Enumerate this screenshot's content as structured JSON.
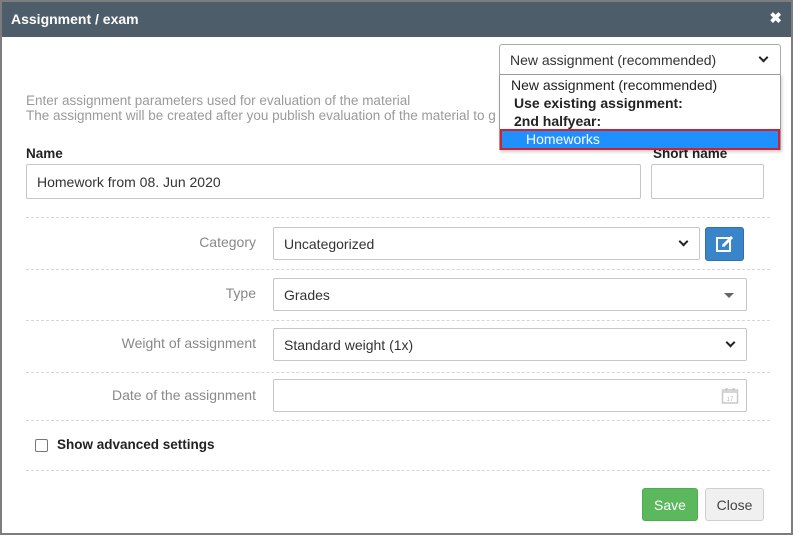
{
  "dialog": {
    "title": "Assignment / exam",
    "close_icon": "close-x-icon"
  },
  "assignment_select": {
    "value": "New assignment (recommended)",
    "options": {
      "new": "New assignment (recommended)",
      "use_existing_group": "Use existing assignment:",
      "half_year_group": "2nd halfyear:",
      "homeworks": "Homeworks"
    },
    "selected_option": "Homeworks",
    "highlight_color": "#1e90ff",
    "selection_outline_color": "#d0222c"
  },
  "help_text": {
    "line1": "Enter assignment parameters used for evaluation of the material",
    "line2": "The assignment will be created after you publish evaluation of the material to gr"
  },
  "name": {
    "label": "Name",
    "value": "Homework from 08. Jun 2020"
  },
  "short_name": {
    "label": "Short name",
    "value": ""
  },
  "category": {
    "label": "Category",
    "value": "Uncategorized",
    "edit_icon": "edit-icon"
  },
  "type": {
    "label": "Type",
    "value": "Grades"
  },
  "weight": {
    "label": "Weight of assignment",
    "value": "Standard weight (1x)"
  },
  "date": {
    "label": "Date of the assignment",
    "value": "",
    "calendar_icon": "calendar-icon"
  },
  "advanced": {
    "label": "Show advanced settings",
    "checked": false
  },
  "buttons": {
    "save": "Save",
    "close": "Close"
  },
  "colors": {
    "titlebar": "#4d5d69",
    "save_button": "#5cb85c",
    "edit_button": "#3a84c9"
  }
}
